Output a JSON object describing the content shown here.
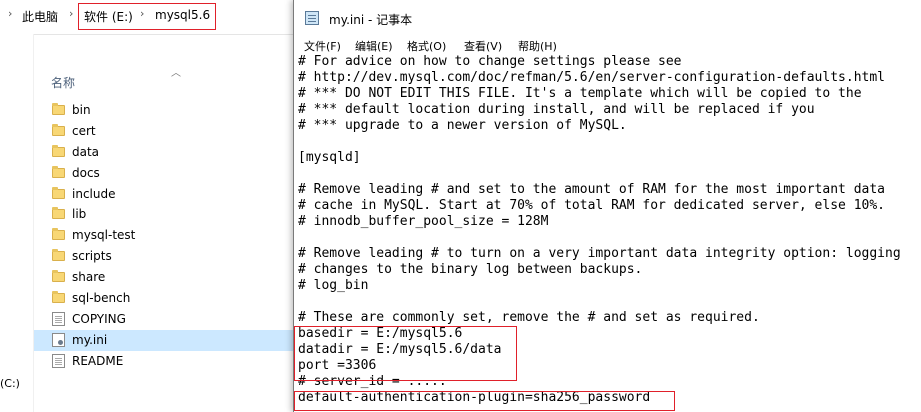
{
  "explorer": {
    "breadcrumb": [
      "此电脑",
      "软件 (E:)",
      "mysql5.6"
    ],
    "column_header": "名称",
    "drive_c_label": "(C:)",
    "items": [
      {
        "name": "bin",
        "type": "folder"
      },
      {
        "name": "cert",
        "type": "folder"
      },
      {
        "name": "data",
        "type": "folder"
      },
      {
        "name": "docs",
        "type": "folder"
      },
      {
        "name": "include",
        "type": "folder"
      },
      {
        "name": "lib",
        "type": "folder"
      },
      {
        "name": "mysql-test",
        "type": "folder"
      },
      {
        "name": "scripts",
        "type": "folder"
      },
      {
        "name": "share",
        "type": "folder"
      },
      {
        "name": "sql-bench",
        "type": "folder"
      },
      {
        "name": "COPYING",
        "type": "file"
      },
      {
        "name": "my.ini",
        "type": "ini",
        "selected": true
      },
      {
        "name": "README",
        "type": "file"
      }
    ]
  },
  "notepad": {
    "title": "my.ini - 记事本",
    "menu": [
      "文件(F)",
      "编辑(E)",
      "格式(O)",
      "查看(V)",
      "帮助(H)"
    ],
    "lines": [
      "# For advice on how to change settings please see",
      "# http://dev.mysql.com/doc/refman/5.6/en/server-configuration-defaults.html",
      "# *** DO NOT EDIT THIS FILE. It's a template which will be copied to the",
      "# *** default location during install, and will be replaced if you",
      "# *** upgrade to a newer version of MySQL.",
      "",
      "[mysqld]",
      "",
      "# Remove leading # and set to the amount of RAM for the most important data",
      "# cache in MySQL. Start at 70% of total RAM for dedicated server, else 10%.",
      "# innodb_buffer_pool_size = 128M",
      "",
      "# Remove leading # to turn on a very important data integrity option: logging",
      "# changes to the binary log between backups.",
      "# log_bin",
      "",
      "# These are commonly set, remove the # and set as required.",
      "basedir = E:/mysql5.6",
      "datadir = E:/mysql5.6/data",
      "port =3306",
      "# server_id = .....",
      "default-authentication-plugin=sha256_password"
    ]
  },
  "colors": {
    "highlight_border": "#e0202a",
    "selection_bg": "#cce8ff"
  }
}
